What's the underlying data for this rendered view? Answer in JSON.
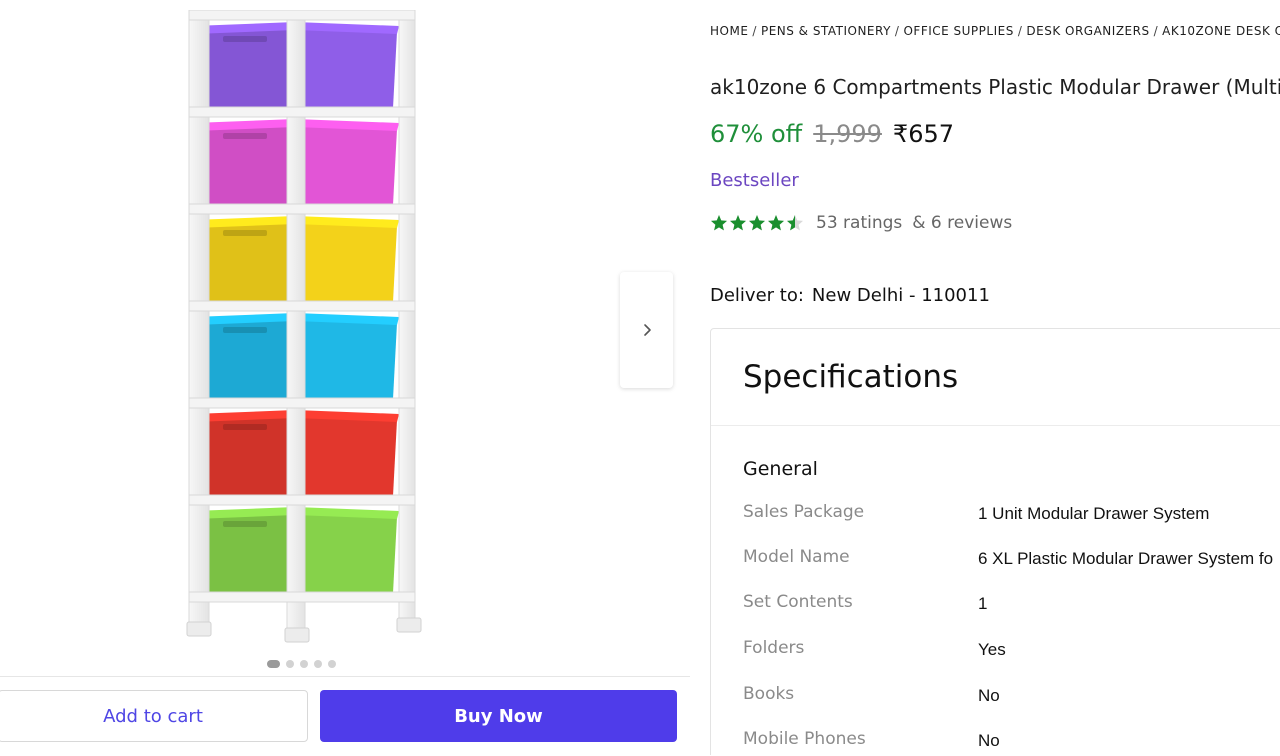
{
  "gallery": {
    "image_alt": "ak10zone 6 compartment multicolour modular drawer",
    "drawer_colors": [
      "#8f5ee8",
      "#e255d6",
      "#f3d21a",
      "#1fb8e6",
      "#e2372d",
      "#86d24a"
    ],
    "dots": {
      "count": 5,
      "active_index": 0
    },
    "next_icon": "chevron-right-icon"
  },
  "actions": {
    "add_to_cart": "Add to cart",
    "buy_now": "Buy Now"
  },
  "breadcrumb": [
    "HOME",
    "PENS & STATIONERY",
    "OFFICE SUPPLIES",
    "DESK ORGANIZERS",
    "AK10ZONE DESK O"
  ],
  "product": {
    "title": "ak10zone 6 Compartments Plastic Modular Drawer (Multic",
    "discount": "67% off",
    "mrp": "1,999",
    "price": "₹657",
    "badge": "Bestseller",
    "rating": 4.5,
    "ratings_text": "53 ratings",
    "reviews_text": "& 6 reviews"
  },
  "delivery": {
    "label": "Deliver to:",
    "location": "New Delhi - 110011"
  },
  "specifications": {
    "title": "Specifications",
    "group": "General",
    "rows": [
      {
        "key": "Sales Package",
        "value": "1 Unit Modular Drawer System"
      },
      {
        "key": "Model Name",
        "value": "6 XL Plastic Modular Drawer System fo"
      },
      {
        "key": "Set Contents",
        "value": "1"
      },
      {
        "key": "Folders",
        "value": "Yes"
      },
      {
        "key": "Books",
        "value": "No"
      },
      {
        "key": "Mobile Phones",
        "value": "No"
      }
    ]
  },
  "colors": {
    "accent": "#4f3cea",
    "discount_green": "#1f8f3a",
    "star_green": "#1a8f2e",
    "bestseller_purple": "#6b46c1"
  }
}
